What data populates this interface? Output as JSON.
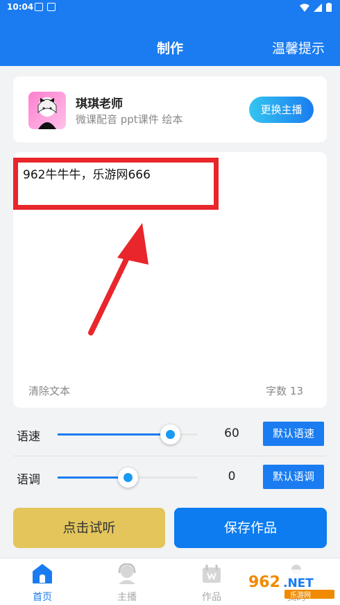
{
  "status_bar": {
    "time": "10:04"
  },
  "header": {
    "title": "制作",
    "tips": "温馨提示"
  },
  "anchor": {
    "name": "琪琪老师",
    "description": "微课配音 ppt课件 绘本",
    "change_label": "更换主播"
  },
  "editor": {
    "text": "962牛牛牛，乐游网666",
    "clear_label": "清除文本",
    "word_count": "字数 13"
  },
  "speed": {
    "label": "语速",
    "value": "60",
    "level": 0.8,
    "default_label": "默认语速"
  },
  "pitch": {
    "label": "语调",
    "value": "0",
    "level": 0.5,
    "default_label": "默认语调"
  },
  "actions": {
    "listen_label": "点击试听",
    "save_label": "保存作品"
  },
  "nav": {
    "items": [
      {
        "label": "首页",
        "icon": "home-icon",
        "active": true
      },
      {
        "label": "主播",
        "icon": "headset-icon",
        "active": false
      },
      {
        "label": "作品",
        "icon": "works-icon",
        "active": false
      },
      {
        "label": "我的",
        "icon": "profile-icon",
        "active": false
      }
    ]
  },
  "watermark": {
    "brand": "962.NET",
    "site": "乐游网"
  },
  "colors": {
    "primary": "#1a7cf0",
    "listen": "#e3c55c",
    "annotation": "#e8262b"
  }
}
